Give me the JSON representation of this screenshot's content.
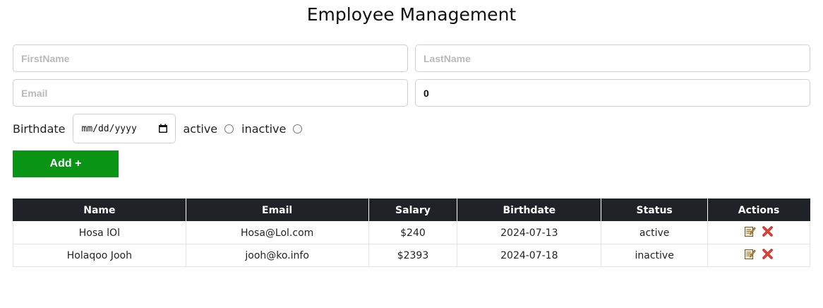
{
  "page_title": "Employee Management",
  "form": {
    "first_name_placeholder": "FirstName",
    "last_name_placeholder": "LastName",
    "email_placeholder": "Email",
    "salary_value": "0",
    "birthdate_label": "Birthdate",
    "birthdate_value": "mm/dd/yyyy",
    "active_label": "active",
    "inactive_label": "inactive",
    "add_button_label": "Add +"
  },
  "table": {
    "headers": [
      "Name",
      "Email",
      "Salary",
      "Birthdate",
      "Status",
      "Actions"
    ],
    "rows": [
      {
        "name": "Hosa lOl",
        "email": "Hosa@Lol.com",
        "salary": "$240",
        "birthdate": "2024-07-13",
        "status": "active"
      },
      {
        "name": "Holaqoo Jooh",
        "email": "jooh@ko.info",
        "salary": "$2393",
        "birthdate": "2024-07-18",
        "status": "inactive"
      }
    ]
  },
  "colors": {
    "add_button": "#0a9416",
    "header_bg": "#1f2226",
    "status_active": "#2a8a2f",
    "status_inactive": "#8a2a2a"
  },
  "icons": {
    "edit": "edit-memo-icon",
    "delete": "delete-x-icon",
    "calendar": "calendar-icon"
  }
}
